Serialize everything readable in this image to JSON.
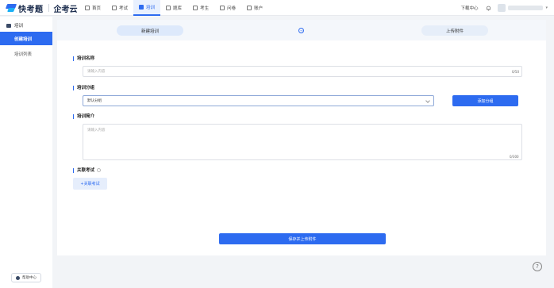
{
  "brand": {
    "name": "快考题",
    "sub": "企考云"
  },
  "nav": [
    {
      "label": "首页",
      "icon": "home-icon"
    },
    {
      "label": "考试",
      "icon": "exam-icon"
    },
    {
      "label": "培训",
      "icon": "training-icon",
      "active": true
    },
    {
      "label": "题库",
      "icon": "question-bank-icon"
    },
    {
      "label": "考生",
      "icon": "candidate-icon"
    },
    {
      "label": "问卷",
      "icon": "survey-icon"
    },
    {
      "label": "账户",
      "icon": "account-icon"
    }
  ],
  "header_right": {
    "download_label": "下载中心"
  },
  "sidebar": {
    "section": "培训",
    "items": [
      {
        "label": "创建培训",
        "active": true
      },
      {
        "label": "培训列表"
      }
    ],
    "help_label": "帮助中心"
  },
  "steps": {
    "step1": "新建培训",
    "step2": "上传附件"
  },
  "form": {
    "name_label": "培训名称",
    "name_placeholder": "请输入内容",
    "name_count": "0/50",
    "group_label": "培训分组",
    "group_value": "默认分组",
    "add_group_label": "添加分组",
    "intro_label": "培训简介",
    "intro_placeholder": "请输入内容",
    "intro_count": "0/300",
    "link_exam_label": "关联考试",
    "link_exam_button": "+关联考试",
    "save_button": "保存并上传附件"
  },
  "colors": {
    "primary": "#2d6bf0",
    "sidebar_active": "#2d6bf0"
  }
}
